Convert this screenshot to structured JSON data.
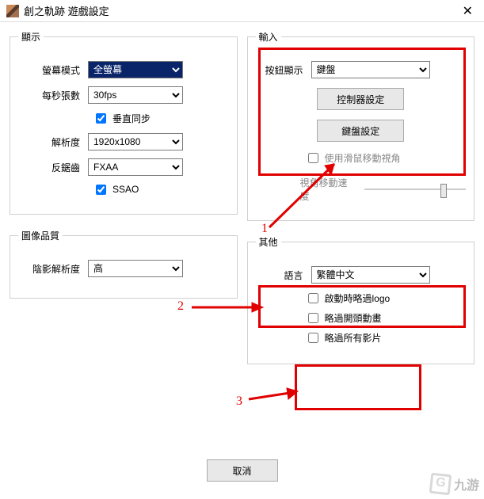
{
  "titlebar": {
    "title": "創之軌跡 遊戲設定"
  },
  "display": {
    "legend": "顯示",
    "screen_mode_label": "螢幕模式",
    "screen_mode_value": "全螢幕",
    "fps_label": "每秒張數",
    "fps_value": "30fps",
    "vsync_label": "垂直同步",
    "vsync_checked": true,
    "resolution_label": "解析度",
    "resolution_value": "1920x1080",
    "aa_label": "反鋸齒",
    "aa_value": "FXAA",
    "ssao_label": "SSAO",
    "ssao_checked": true
  },
  "quality": {
    "legend": "圖像品質",
    "shadow_label": "陰影解析度",
    "shadow_value": "高"
  },
  "input": {
    "legend": "輸入",
    "prompt_label": "按鈕顯示",
    "prompt_value": "鍵盤",
    "controller_btn": "控制器設定",
    "keyboard_btn": "鍵盤設定",
    "mouse_cam_label": "使用滑鼠移動視角",
    "camera_speed_label": "視角移動速度"
  },
  "other": {
    "legend": "其他",
    "lang_label": "語言",
    "lang_value": "繁體中文",
    "skip_logo_label": "啟動時略過logo",
    "skip_intro_label": "略過開頭動畫",
    "skip_all_label": "略過所有影片"
  },
  "footer": {
    "cancel": "取消"
  },
  "annotations": {
    "n1": "1",
    "n2": "2",
    "n3": "3"
  },
  "watermark": "九游"
}
